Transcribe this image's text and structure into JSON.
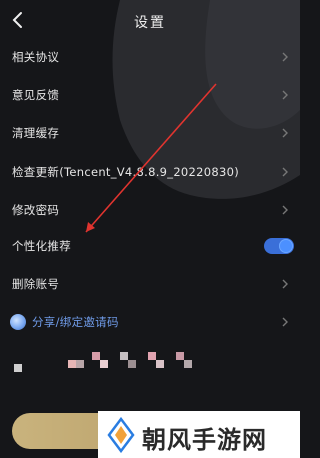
{
  "header": {
    "title": "设置"
  },
  "menu": {
    "items": [
      {
        "label": "相关协议"
      },
      {
        "label": "意见反馈"
      },
      {
        "label": "清理缓存"
      },
      {
        "label": "检查更新(Tencent_V4.8.8.9_20220830)"
      },
      {
        "label": "修改密码"
      },
      {
        "label": "个性化推荐",
        "toggle_on": true
      },
      {
        "label": "删除账号"
      },
      {
        "label": "分享/绑定邀请码"
      }
    ]
  },
  "watermark": {
    "text": "朝风手游网"
  },
  "colors": {
    "background": "#151619",
    "accent_blue": "#4c90ff",
    "share_text": "#6f9be8",
    "annotation_arrow": "#e0342f",
    "bottom_button": "#c9b37d"
  },
  "icons": [
    "back-chevron-icon",
    "chevron-right-icon",
    "toggle-switch",
    "share-avatar-icon",
    "watermark-logo-icon"
  ]
}
